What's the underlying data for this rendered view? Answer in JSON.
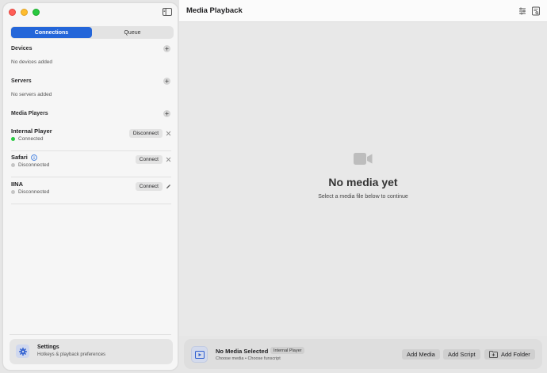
{
  "sidebar": {
    "tabs": [
      {
        "label": "Connections",
        "active": true
      },
      {
        "label": "Queue",
        "active": false
      }
    ],
    "sections": {
      "devices": {
        "title": "Devices",
        "empty": "No devices added"
      },
      "servers": {
        "title": "Servers",
        "empty": "No servers added"
      },
      "media_players": {
        "title": "Media Players"
      }
    },
    "players": [
      {
        "name": "Internal Player",
        "status": "Connected",
        "button": "Disconnect",
        "trailing_icon": "close-icon",
        "has_info": false
      },
      {
        "name": "Safari",
        "status": "Disconnected",
        "button": "Connect",
        "trailing_icon": "close-icon",
        "has_info": true
      },
      {
        "name": "IINA",
        "status": "Disconnected",
        "button": "Connect",
        "trailing_icon": "pencil-icon",
        "has_info": false
      }
    ],
    "settings": {
      "title": "Settings",
      "subtitle": "Hotkeys & playback preferences",
      "icon": "gear-icon"
    }
  },
  "main": {
    "title": "Media Playback",
    "header_icons": [
      "list-settings-icon",
      "inspector-icon"
    ],
    "empty_state": {
      "icon": "video-camera-icon",
      "title": "No media yet",
      "subtitle": "Select a media file below to continue"
    },
    "bottom_bar": {
      "title": "No Media Selected",
      "player_chip": "Internal Player",
      "subtitle": "Choose media • Choose funscript",
      "buttons": {
        "add_media": "Add Media",
        "add_script": "Add Script",
        "add_folder": "Add Folder"
      }
    }
  },
  "colors": {
    "accent": "#2466d9",
    "connected": "#28c840",
    "disconnected": "#c5c5c5"
  }
}
